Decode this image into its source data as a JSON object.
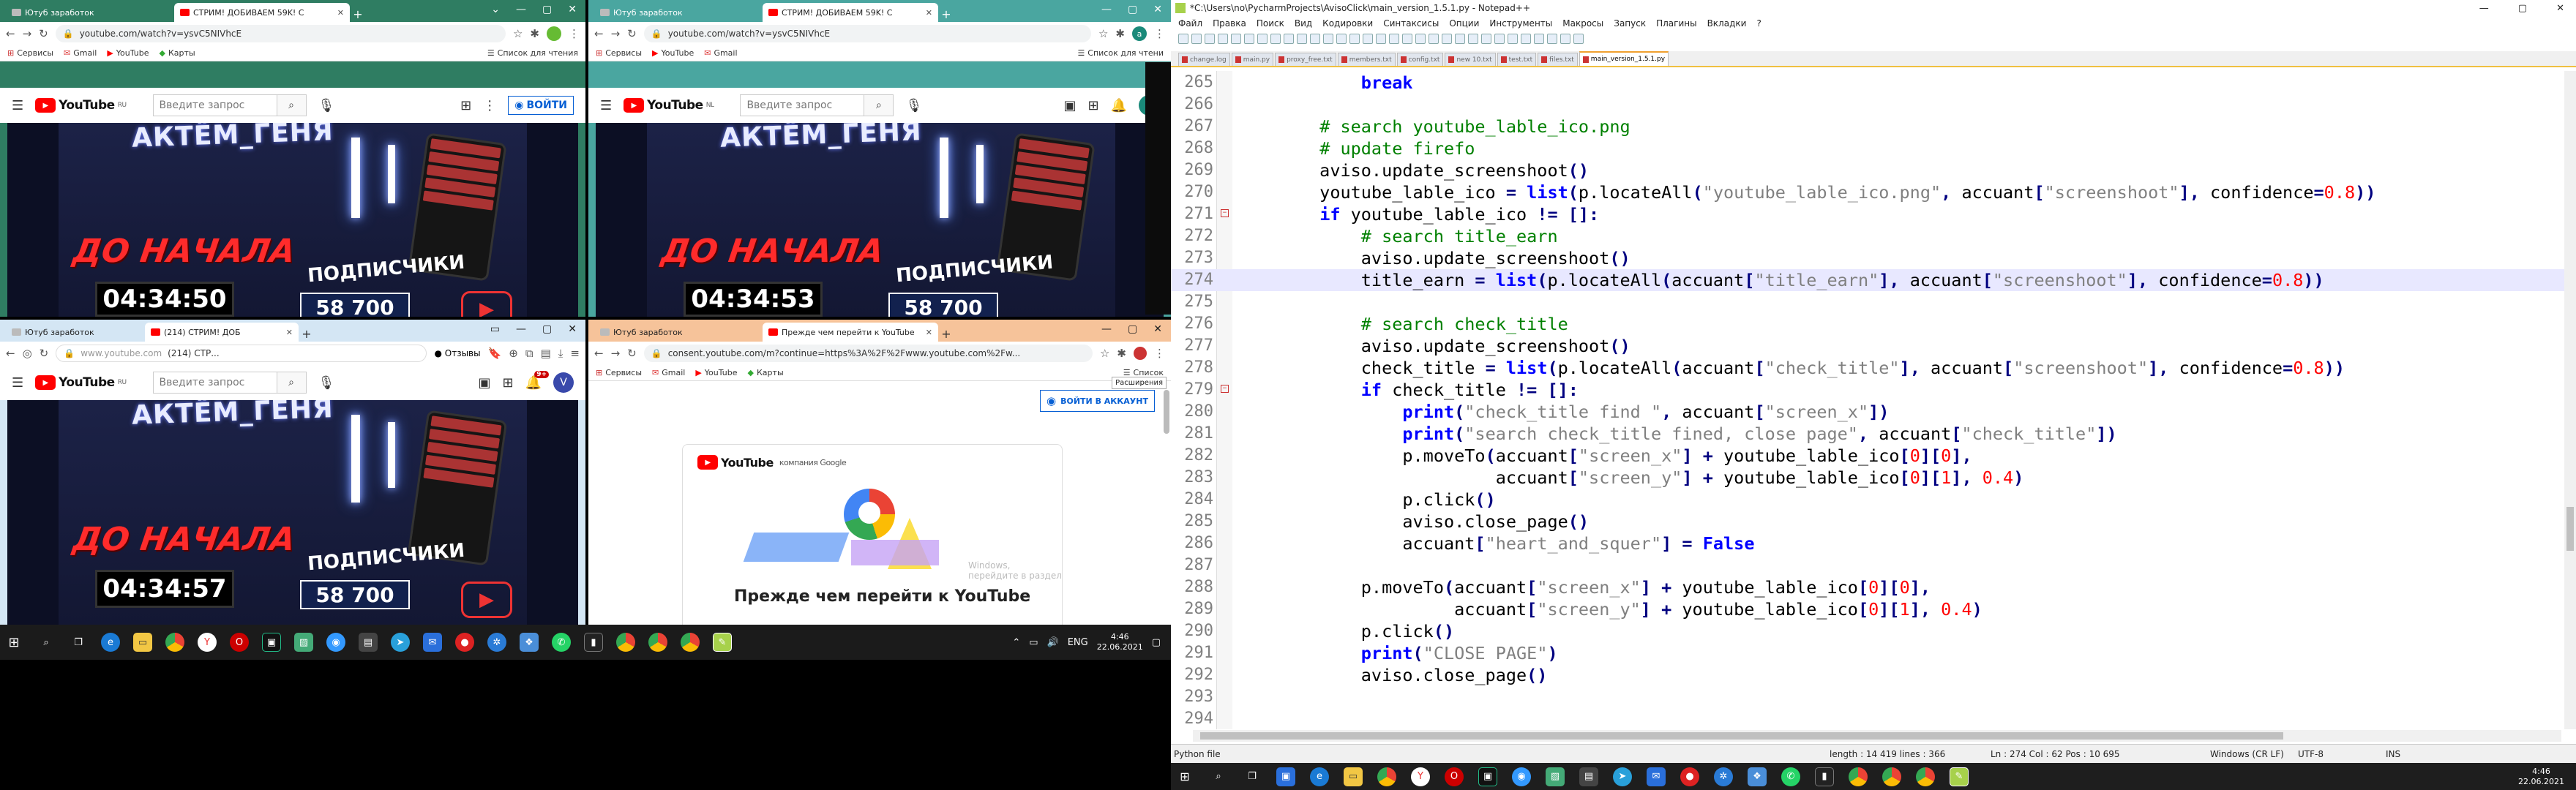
{
  "browsers": [
    {
      "id": "tl",
      "tabs": [
        {
          "label": "Ютуб заработок",
          "active": false
        },
        {
          "label": "СТРИМ! ДОБИВАЕМ 59K! С",
          "active": true
        }
      ],
      "url": "youtube.com/watch?v=ysvC5NIVhcE",
      "bookmarks": [
        "Сервисы",
        "Gmail",
        "YouTube",
        "Карты"
      ],
      "reading_list": "Список для чтения",
      "signin": "ВОЙТИ",
      "search_placeholder": "Введите запрос",
      "countdown": "04:34:50",
      "yt_region": "RU"
    },
    {
      "id": "tr",
      "tabs": [
        {
          "label": "Ютуб заработок",
          "active": false
        },
        {
          "label": "СТРИМ! ДОБИВАЕМ 59K! C",
          "active": true
        }
      ],
      "url": "youtube.com/watch?v=ysvC5NIVhcE",
      "bookmarks": [
        "Сервисы",
        "YouTube",
        "Gmail"
      ],
      "reading_list": "Список для чтени",
      "search_placeholder": "Введите запрос",
      "countdown": "04:34:53",
      "yt_region": "NL",
      "avatar": "a"
    },
    {
      "id": "bl",
      "tabs": [
        {
          "label": "Ютуб заработок",
          "active": false
        },
        {
          "label": "(214) СТРИМ! ДОБ",
          "active": true
        }
      ],
      "url_host": "www.youtube.com",
      "url_title": "(214) СТР...",
      "feedback": "Отзывы",
      "search_placeholder": "Введите запрос",
      "countdown": "04:34:57",
      "yt_region": "RU",
      "notif_count": "9+",
      "avatar": "V"
    },
    {
      "id": "br",
      "tabs": [
        {
          "label": "Ютуб заработок",
          "active": false
        },
        {
          "label": "Прежде чем перейти к YouTube",
          "active": true
        }
      ],
      "url": "consent.youtube.com/m?continue=https%3A%2F%2Fwww.youtube.com%2Fw...",
      "bookmarks": [
        "Сервисы",
        "Gmail",
        "YouTube",
        "Карты"
      ],
      "reading_list": "Список",
      "tooltip": "Расширения",
      "signin": "ВОЙТИ В АККАУНТ",
      "consent_brand": "компания Google",
      "consent_windows": "Windows, перейдите в раздел",
      "consent_heading": "Прежде чем перейти к YouTube"
    }
  ],
  "video": {
    "banner": "АКТЁМ_ГЕНЯ",
    "before_start": "ДО НАЧАЛА",
    "subscribers_label": "ПОДПИСЧИКИ",
    "subscribers_value": "58 700"
  },
  "left_taskbar": {
    "lang": "ENG",
    "time": "4:46",
    "date": "22.06.2021"
  },
  "notepad": {
    "title": "*C:\\Users\\no\\PycharmProjects\\AvisoClick\\main_version_1.5.1.py - Notepad++",
    "menu": [
      "Файл",
      "Правка",
      "Поиск",
      "Вид",
      "Кодировки",
      "Синтаксисы",
      "Опции",
      "Инструменты",
      "Макросы",
      "Запуск",
      "Плагины",
      "Вкладки",
      "?"
    ],
    "file_tabs": [
      "change.log",
      "main.py",
      "proxy_free.txt",
      "members.txt",
      "config.txt",
      "new 10.txt",
      "test.txt",
      "files.txt",
      "main_version_1.5.1.py"
    ],
    "active_tab": "main_version_1.5.1.py",
    "lines": [
      {
        "n": "265",
        "html": "            <span class='kw'>break</span>"
      },
      {
        "n": "266",
        "html": ""
      },
      {
        "n": "267",
        "html": "        <span class='cm'># search youtube_lable_ico.png</span>"
      },
      {
        "n": "268",
        "html": "        <span class='cm'># update firefo</span>"
      },
      {
        "n": "269",
        "html": "        aviso.update_screenshoot<span class='op'>()</span>"
      },
      {
        "n": "270",
        "html": "        youtube_lable_ico <span class='op'>=</span> <span class='kw'>list</span><span class='op'>(</span>p.locateAll<span class='op'>(</span><span class='st'>\"youtube_lable_ico.png\"</span><span class='op'>,</span> accuant<span class='op'>[</span><span class='st'>\"screenshoot\"</span><span class='op'>],</span> confidence<span class='op'>=</span><span class='nm'>0.8</span><span class='op'>))</span>"
      },
      {
        "n": "271",
        "html": "        <span class='kw'>if</span> youtube_lable_ico <span class='op'>!=</span> <span class='op'>[]:</span>"
      },
      {
        "n": "272",
        "html": "            <span class='cm'># search title_earn</span>"
      },
      {
        "n": "273",
        "html": "            aviso.update_screenshoot<span class='op'>()</span>"
      },
      {
        "n": "274",
        "html": "            title_earn <span class='op'>=</span> <span class='kw'>list</span><span class='op'>(</span>p.locateAll<span class='op'>(</span>accuant<span class='op'>[</span><span class='st'>\"title_earn\"</span><span class='op'>],</span> accuant<span class='op'>[</span><span class='st'>\"screenshoot\"</span><span class='op'>],</span> confidence<span class='op'>=</span><span class='nm'>0.8</span><span class='op'>))</span>"
      },
      {
        "n": "275",
        "html": ""
      },
      {
        "n": "276",
        "html": "            <span class='cm'># search check_title</span>"
      },
      {
        "n": "277",
        "html": "            aviso.update_screenshoot<span class='op'>()</span>"
      },
      {
        "n": "278",
        "html": "            check_title <span class='op'>=</span> <span class='kw'>list</span><span class='op'>(</span>p.locateAll<span class='op'>(</span>accuant<span class='op'>[</span><span class='st'>\"check_title\"</span><span class='op'>],</span> accuant<span class='op'>[</span><span class='st'>\"screenshoot\"</span><span class='op'>],</span> confidence<span class='op'>=</span><span class='nm'>0.8</span><span class='op'>))</span>"
      },
      {
        "n": "279",
        "html": "            <span class='kw'>if</span> check_title <span class='op'>!=</span> <span class='op'>[]:</span>"
      },
      {
        "n": "280",
        "html": "                <span class='kw'>print</span><span class='op'>(</span><span class='st'>\"check_title find \"</span><span class='op'>,</span> accuant<span class='op'>[</span><span class='st'>\"screen_x\"</span><span class='op'>])</span>"
      },
      {
        "n": "281",
        "html": "                <span class='kw'>print</span><span class='op'>(</span><span class='st'>\"search check_title fined, close page\"</span><span class='op'>,</span> accuant<span class='op'>[</span><span class='st'>\"check_title\"</span><span class='op'>])</span>"
      },
      {
        "n": "282",
        "html": "                p.moveTo<span class='op'>(</span>accuant<span class='op'>[</span><span class='st'>\"screen_x\"</span><span class='op'>]</span> <span class='op'>+</span> youtube_lable_ico<span class='op'>[</span><span class='nm'>0</span><span class='op'>][</span><span class='nm'>0</span><span class='op'>],</span>"
      },
      {
        "n": "283",
        "html": "                         accuant<span class='op'>[</span><span class='st'>\"screen_y\"</span><span class='op'>]</span> <span class='op'>+</span> youtube_lable_ico<span class='op'>[</span><span class='nm'>0</span><span class='op'>][</span><span class='nm'>1</span><span class='op'>],</span> <span class='nm'>0.4</span><span class='op'>)</span>"
      },
      {
        "n": "284",
        "html": "                p.click<span class='op'>()</span>"
      },
      {
        "n": "285",
        "html": "                aviso.close_page<span class='op'>()</span>"
      },
      {
        "n": "286",
        "html": "                accuant<span class='op'>[</span><span class='st'>\"heart_and_squer\"</span><span class='op'>]</span> <span class='op'>=</span> <span class='kw'>False</span>"
      },
      {
        "n": "287",
        "html": ""
      },
      {
        "n": "288",
        "html": "            p.moveTo<span class='op'>(</span>accuant<span class='op'>[</span><span class='st'>\"screen_x\"</span><span class='op'>]</span> <span class='op'>+</span> youtube_lable_ico<span class='op'>[</span><span class='nm'>0</span><span class='op'>][</span><span class='nm'>0</span><span class='op'>],</span>"
      },
      {
        "n": "289",
        "html": "                     accuant<span class='op'>[</span><span class='st'>\"screen_y\"</span><span class='op'>]</span> <span class='op'>+</span> youtube_lable_ico<span class='op'>[</span><span class='nm'>0</span><span class='op'>][</span><span class='nm'>1</span><span class='op'>],</span> <span class='nm'>0.4</span><span class='op'>)</span>"
      },
      {
        "n": "290",
        "html": "            p.click<span class='op'>()</span>"
      },
      {
        "n": "291",
        "html": "            <span class='kw'>print</span><span class='op'>(</span><span class='st'>\"CLOSE PAGE\"</span><span class='op'>)</span>"
      },
      {
        "n": "292",
        "html": "            aviso.close_page<span class='op'>()</span>"
      },
      {
        "n": "293",
        "html": ""
      },
      {
        "n": "294",
        "html": ""
      }
    ],
    "status": {
      "file_type": "Python file",
      "length": "length : 14 419    lines : 366",
      "position": "Ln : 274    Col : 62    Pos : 10 695",
      "eol": "Windows (CR LF)",
      "encoding": "UTF-8",
      "mode": "INS"
    },
    "taskbar": {
      "time": "4:46",
      "date": "22.06.2021"
    }
  },
  "colors": {
    "chrome_green": "#2f7d62",
    "chrome_teal": "#4aa6a0",
    "chrome_lightblue": "#d4e6f4",
    "chrome_orange": "#f6c39a",
    "yt_red": "#ff0000",
    "signin_blue": "#065fd4"
  }
}
